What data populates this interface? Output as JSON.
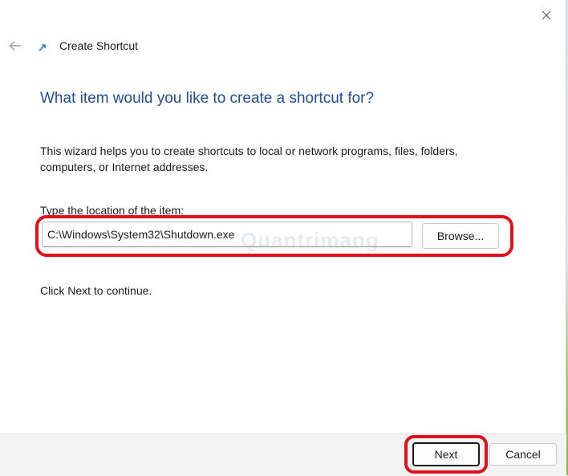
{
  "window": {
    "title": "Create Shortcut"
  },
  "wizard": {
    "heading": "What item would you like to create a shortcut for?",
    "description": "This wizard helps you to create shortcuts to local or network programs, files, folders, computers, or Internet addresses.",
    "location_label": "Type the location of the item:",
    "location_value": "C:\\Windows\\System32\\Shutdown.exe",
    "browse_label": "Browse...",
    "continue_text": "Click Next to continue."
  },
  "footer": {
    "next_label": "Next",
    "cancel_label": "Cancel"
  },
  "watermark": "Quantrimang",
  "colors": {
    "heading": "#1f4e99",
    "highlight": "#e0101c",
    "footer_bg": "#f3f3f3"
  },
  "icons": {
    "close": "close-icon",
    "back": "back-arrow-icon",
    "shortcut": "shortcut-icon"
  }
}
